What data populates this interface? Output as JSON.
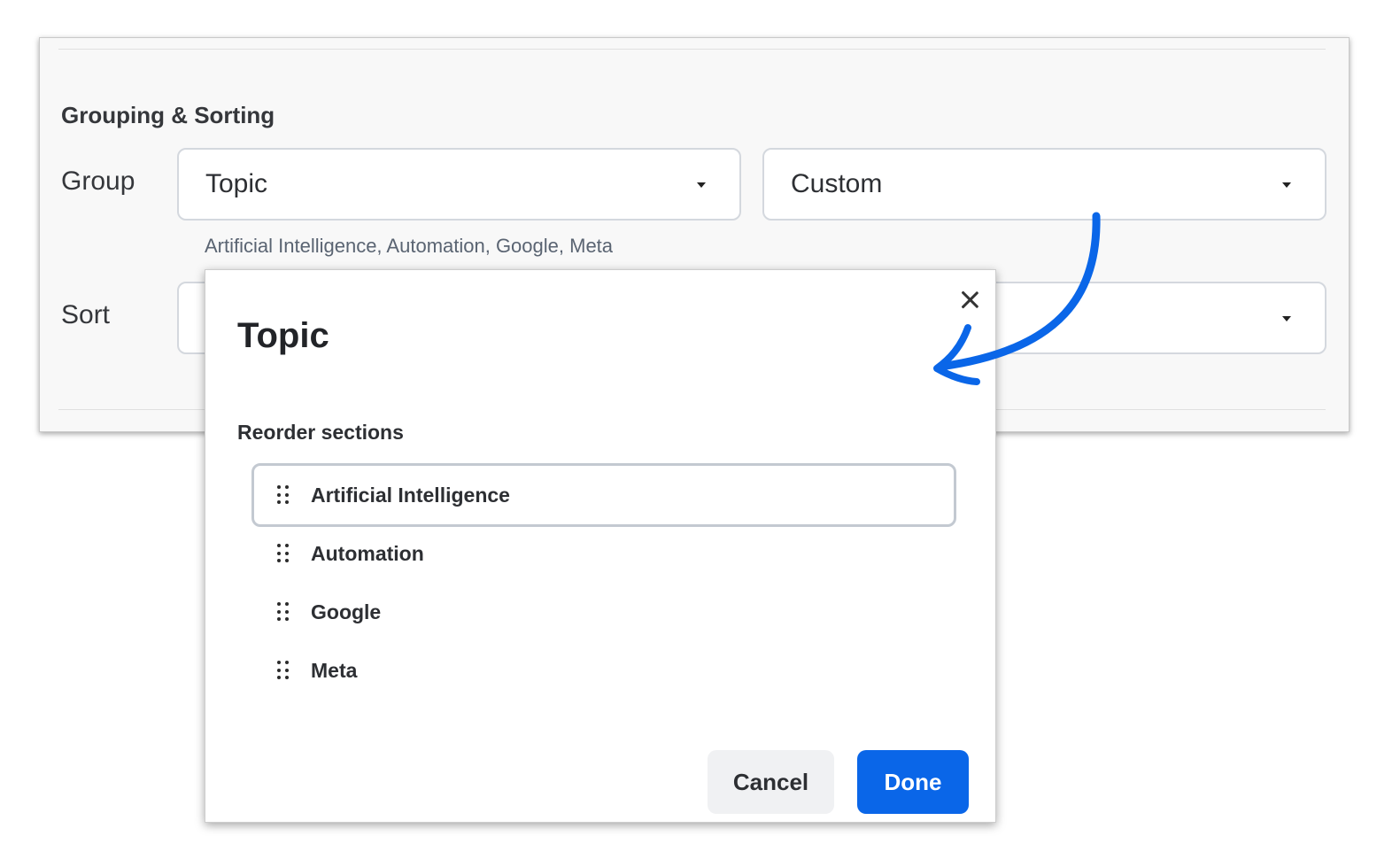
{
  "settings": {
    "section_title": "Grouping & Sorting",
    "group": {
      "label": "Group",
      "field_value": "Topic",
      "order_value": "Custom",
      "helper": "Artificial Intelligence, Automation, Google, Meta"
    },
    "sort": {
      "label": "Sort"
    }
  },
  "modal": {
    "title": "Topic",
    "reorder_label": "Reorder sections",
    "items": [
      {
        "label": "Artificial Intelligence",
        "active": true
      },
      {
        "label": "Automation",
        "active": false
      },
      {
        "label": "Google",
        "active": false
      },
      {
        "label": "Meta",
        "active": false
      }
    ],
    "cancel_label": "Cancel",
    "done_label": "Done"
  },
  "icons": {
    "close": "close-icon",
    "drag": "drag-handle-icon",
    "dropdown": "chevron-down-icon",
    "annotation": "curved-arrow-icon"
  },
  "colors": {
    "primary": "#0a66e8",
    "annotation_arrow": "#0a66e8",
    "panel_background": "#f8f8f8"
  }
}
